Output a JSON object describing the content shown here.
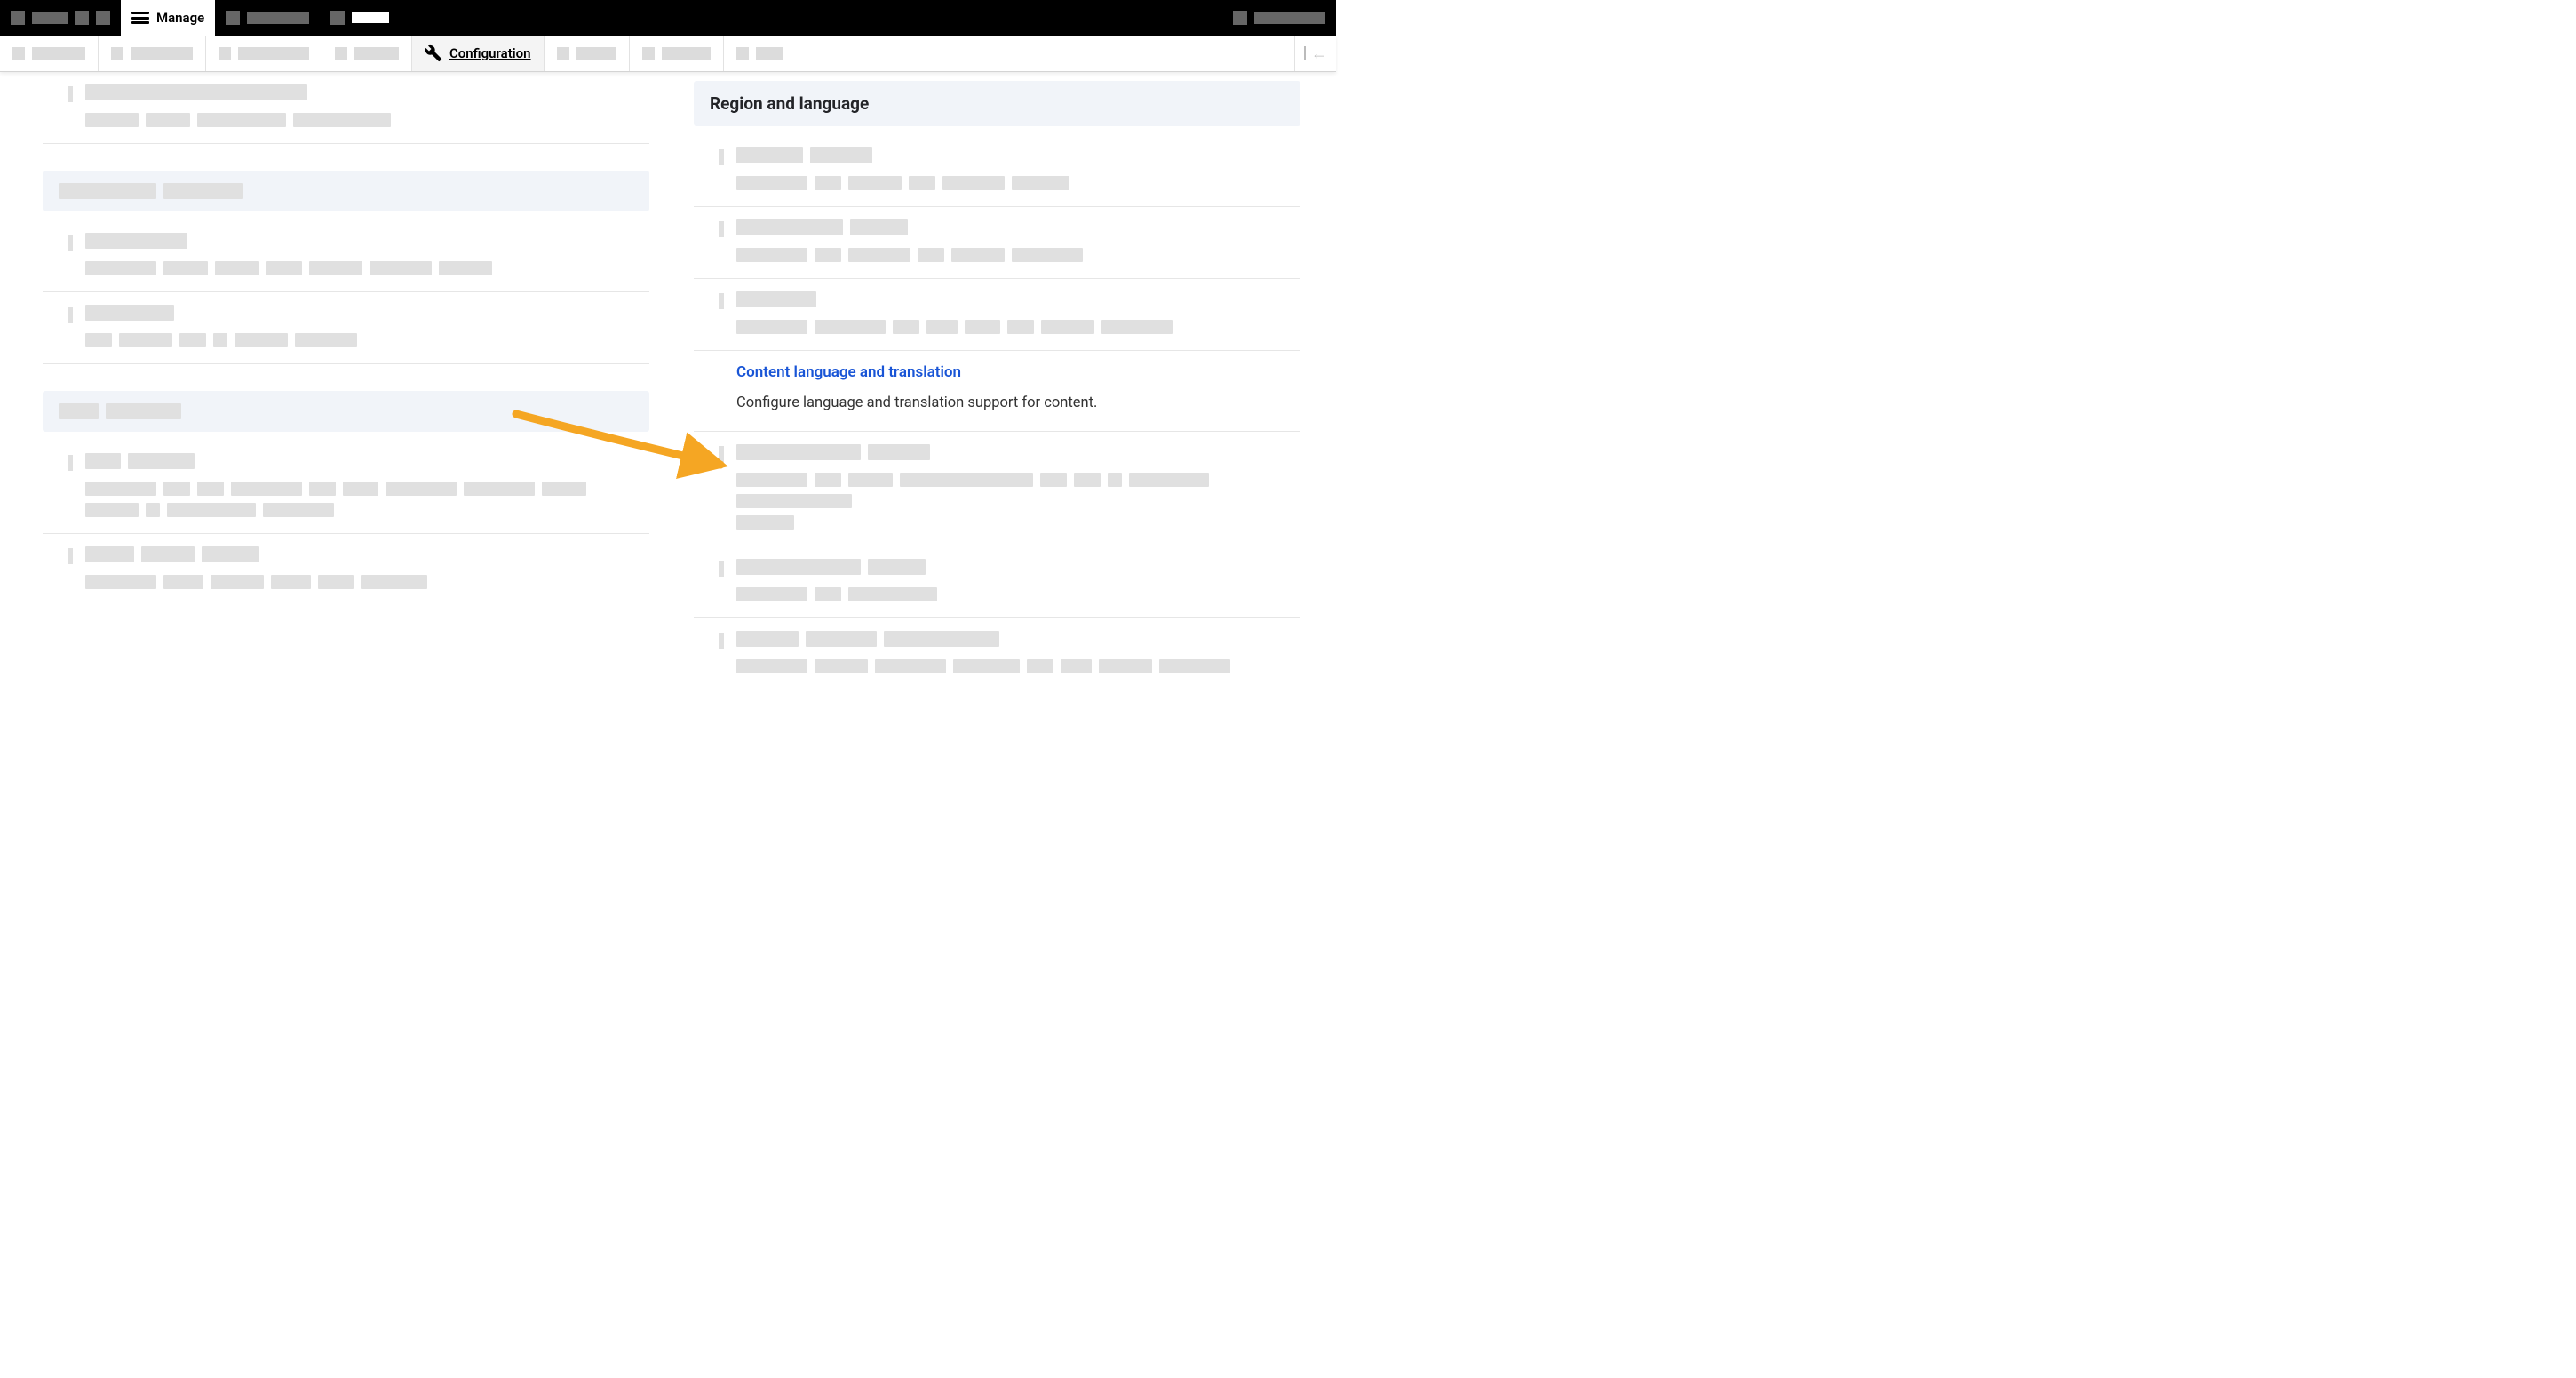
{
  "topbar": {
    "active_tab": "Manage"
  },
  "menubar": {
    "active_item": "Configuration"
  },
  "highlighted_section_title": "Region and language",
  "highlighted_link": {
    "label": "Content language and translation",
    "description": "Configure language and translation support for content."
  }
}
